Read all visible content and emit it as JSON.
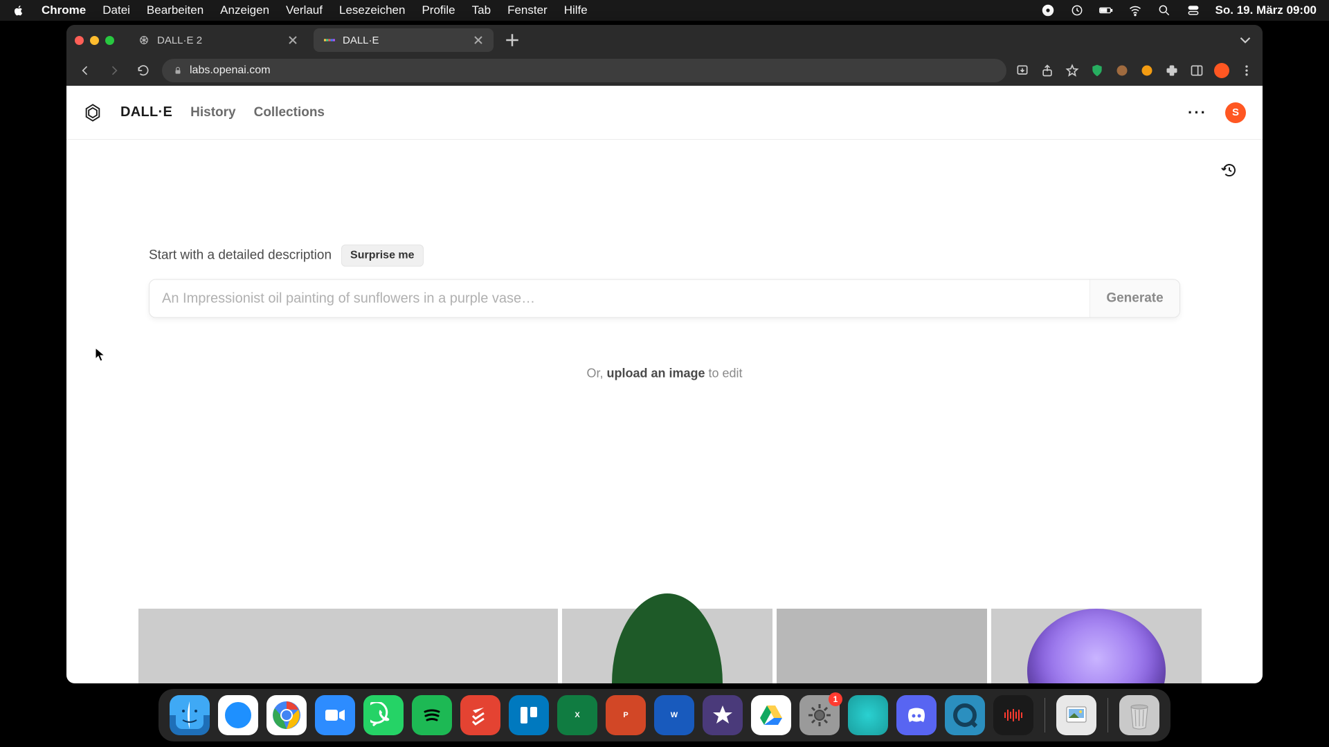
{
  "menubar": {
    "app": "Chrome",
    "items": [
      "Datei",
      "Bearbeiten",
      "Anzeigen",
      "Verlauf",
      "Lesezeichen",
      "Profile",
      "Tab",
      "Fenster",
      "Hilfe"
    ],
    "clock": "So. 19. März  09:00"
  },
  "tabs": {
    "t0": {
      "title": "DALL·E 2"
    },
    "t1": {
      "title": "DALL·E"
    }
  },
  "address": "labs.openai.com",
  "page": {
    "brand": "DALL·E",
    "nav_history": "History",
    "nav_collections": "Collections",
    "user_initial": "S",
    "hint": "Start with a detailed description",
    "surprise": "Surprise me",
    "placeholder": "An Impressionist oil painting of sunflowers in a purple vase…",
    "generate": "Generate",
    "upload_pre": "Or, ",
    "upload_link": "upload an image",
    "upload_post": " to edit"
  },
  "dock": {
    "settings_badge": "1"
  }
}
